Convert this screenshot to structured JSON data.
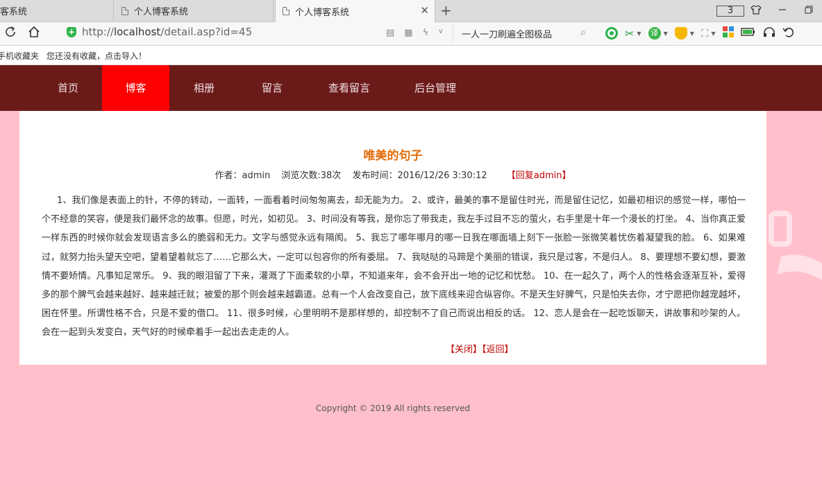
{
  "browser": {
    "tabs": [
      {
        "label": "客系统"
      },
      {
        "label": "个人博客系统"
      },
      {
        "label": "个人博客系统",
        "close": "✕"
      }
    ],
    "new_tab": "+",
    "tab_count": "3",
    "url_prefix": "http://",
    "url_host": "localhost",
    "url_path": "/detail.asp?id=45",
    "search_text": "一人一刀刷遍全图极品",
    "favorites": [
      "手机收藏夹",
      "您还没有收藏，点击导入！"
    ]
  },
  "site_nav": {
    "items": [
      "首页",
      "博客",
      "相册",
      "留言",
      "查看留言",
      "后台管理"
    ],
    "active": "博客"
  },
  "article": {
    "title": "唯美的句子",
    "author": "作者：admin",
    "views": "浏览次数:38次",
    "published": "发布时间：2016/12/26 3:30:12",
    "reply": "【回复admin】",
    "body": "1、我们像是表面上的针，不停的转动，一面转，一面看着时间匆匆离去，却无能为力。 2、或许，最美的事不是留住时光，而是留住记忆，如最初相识的感觉一样，哪怕一个不经意的笑容，便是我们最怀念的故事。但愿，时光，如初见。 3、时间没有等我，是你忘了带我走，我左手过目不忘的萤火，右手里是十年一个漫长的打坐。 4、当你真正爱一样东西的时候你就会发现语言多么的脆弱和无力。文字与感觉永远有隔阂。 5、我忘了哪年哪月的哪一日我在哪面墙上刻下一张脸一张微笑着忧伤着凝望我的脸。 6、如果难过，就努力抬头望天空吧，望着望着就忘了……它那么大，一定可以包容你的所有委屈。 7、我哒哒的马蹄是个美丽的错误，我只是过客，不是归人。 8、要理想不要幻想，要激情不要矫情。凡事知足常乐。 9、我的眼泪留了下来，灌溉了下面柔软的小草，不知道来年，会不会开出一地的记忆和忧愁。 10、在一起久了，两个人的性格会逐渐互补，爱得多的那个脾气会越来越好、越来越迁就；被爱的那个则会越来越霸道。总有一个人会改变自己，放下底线来迎合纵容你。不是天生好脾气，只是怕失去你，才宁愿把你越宠越坏，困在怀里。所谓性格不合，只是不爱的借口。 11、很多时候，心里明明不是那样想的，却控制不了自己而说出相反的话。 12、恋人是会在一起吃饭聊天，讲故事和吵架的人。会在一起到头发变白，天气好的时候牵着手一起出去走走的人。",
    "close_link": "【关闭】",
    "back_link": "【返回】"
  },
  "footer": "Copyright © 2019 All rights reserved",
  "colors": {
    "page_bg": "#ffc0cb",
    "nav_bg": "#6b1a1a",
    "nav_active": "#ff0000",
    "title": "#e36c09",
    "link": "#c00000"
  }
}
